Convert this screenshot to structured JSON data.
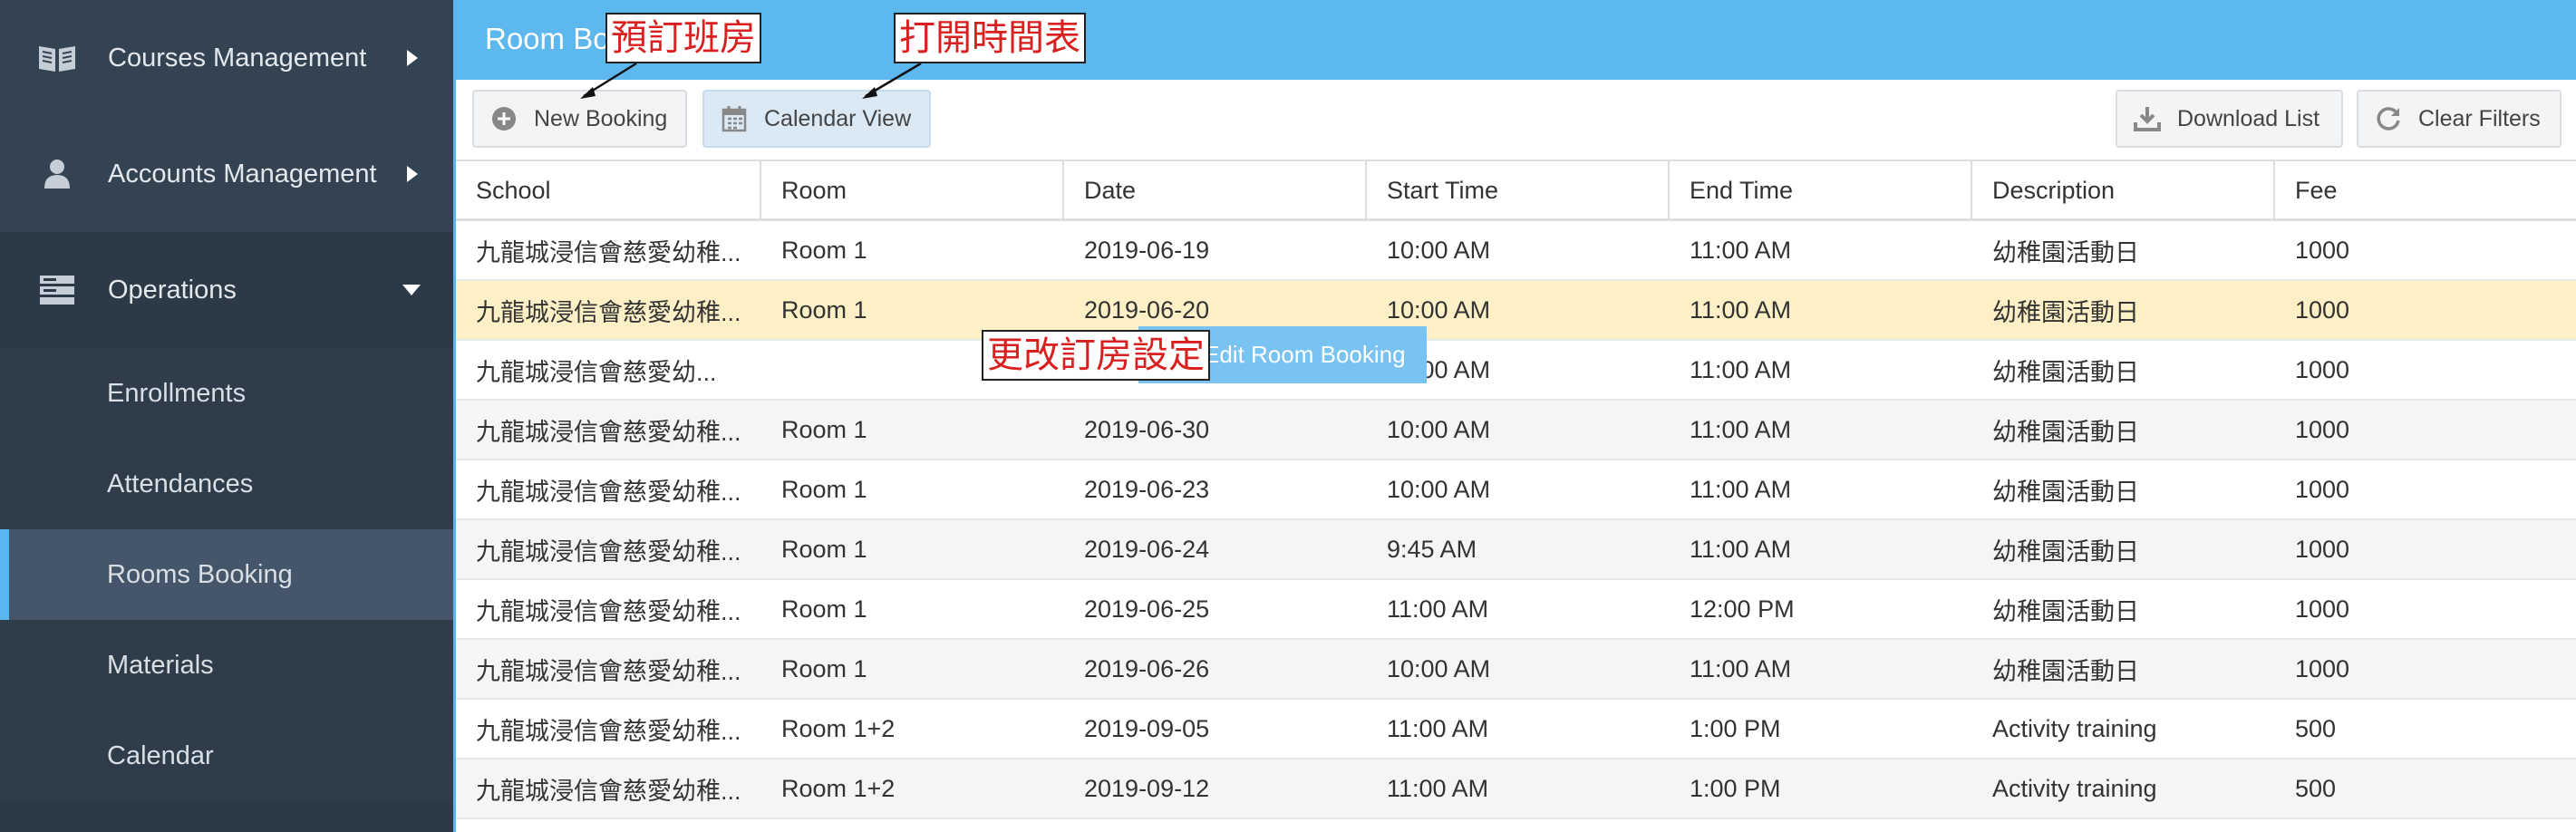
{
  "sidebar": {
    "groups": [
      {
        "label": "Courses Management",
        "icon": "book-icon"
      },
      {
        "label": "Accounts Management",
        "icon": "user-icon"
      },
      {
        "label": "Operations",
        "icon": "server-icon"
      }
    ],
    "sub_items": [
      {
        "label": "Enrollments"
      },
      {
        "label": "Attendances"
      },
      {
        "label": "Rooms Booking"
      },
      {
        "label": "Materials"
      },
      {
        "label": "Calendar"
      }
    ],
    "active_item": "Rooms Booking"
  },
  "header": {
    "title": "Room Bo"
  },
  "toolbar": {
    "new_booking": "New Booking",
    "calendar_view": "Calendar View",
    "download_list": "Download List",
    "clear_filters": "Clear Filters"
  },
  "table": {
    "columns": [
      "School",
      "Room",
      "Date",
      "Start Time",
      "End Time",
      "Description",
      "Fee"
    ],
    "rows": [
      [
        "九龍城浸信會慈愛幼稚...",
        "Room 1",
        "2019-06-19",
        "10:00 AM",
        "11:00 AM",
        "幼稚園活動日",
        "1000"
      ],
      [
        "九龍城浸信會慈愛幼稚...",
        "Room 1",
        "2019-06-20",
        "10:00 AM",
        "11:00 AM",
        "幼稚園活動日",
        "1000"
      ],
      [
        "九龍城浸信會慈愛幼...",
        "",
        "",
        "10:00 AM",
        "11:00 AM",
        "幼稚園活動日",
        "1000"
      ],
      [
        "九龍城浸信會慈愛幼稚...",
        "Room 1",
        "2019-06-30",
        "10:00 AM",
        "11:00 AM",
        "幼稚園活動日",
        "1000"
      ],
      [
        "九龍城浸信會慈愛幼稚...",
        "Room 1",
        "2019-06-23",
        "10:00 AM",
        "11:00 AM",
        "幼稚園活動日",
        "1000"
      ],
      [
        "九龍城浸信會慈愛幼稚...",
        "Room 1",
        "2019-06-24",
        "9:45 AM",
        "11:00 AM",
        "幼稚園活動日",
        "1000"
      ],
      [
        "九龍城浸信會慈愛幼稚...",
        "Room 1",
        "2019-06-25",
        "11:00 AM",
        "12:00 PM",
        "幼稚園活動日",
        "1000"
      ],
      [
        "九龍城浸信會慈愛幼稚...",
        "Room 1",
        "2019-06-26",
        "10:00 AM",
        "11:00 AM",
        "幼稚園活動日",
        "1000"
      ],
      [
        "九龍城浸信會慈愛幼稚...",
        "Room 1+2",
        "2019-09-05",
        "11:00 AM",
        "1:00 PM",
        "Activity training",
        "500"
      ],
      [
        "九龍城浸信會慈愛幼稚...",
        "Room 1+2",
        "2019-09-12",
        "11:00 AM",
        "1:00 PM",
        "Activity training",
        "500"
      ]
    ],
    "selected_row": 2
  },
  "context_menu": {
    "label": "Edit Room Booking",
    "icon": "folder-open-icon"
  },
  "annotations": {
    "new_booking_note": "預訂班房",
    "calendar_note": "打開時間表",
    "edit_note": "更改訂房設定"
  },
  "colors": {
    "sidebar_bg": "#2c3a47",
    "header_bg": "#5db8ee",
    "accent": "#5ab6ee",
    "selected_row": "#fdefc6",
    "annotation_text": "#d92020"
  }
}
